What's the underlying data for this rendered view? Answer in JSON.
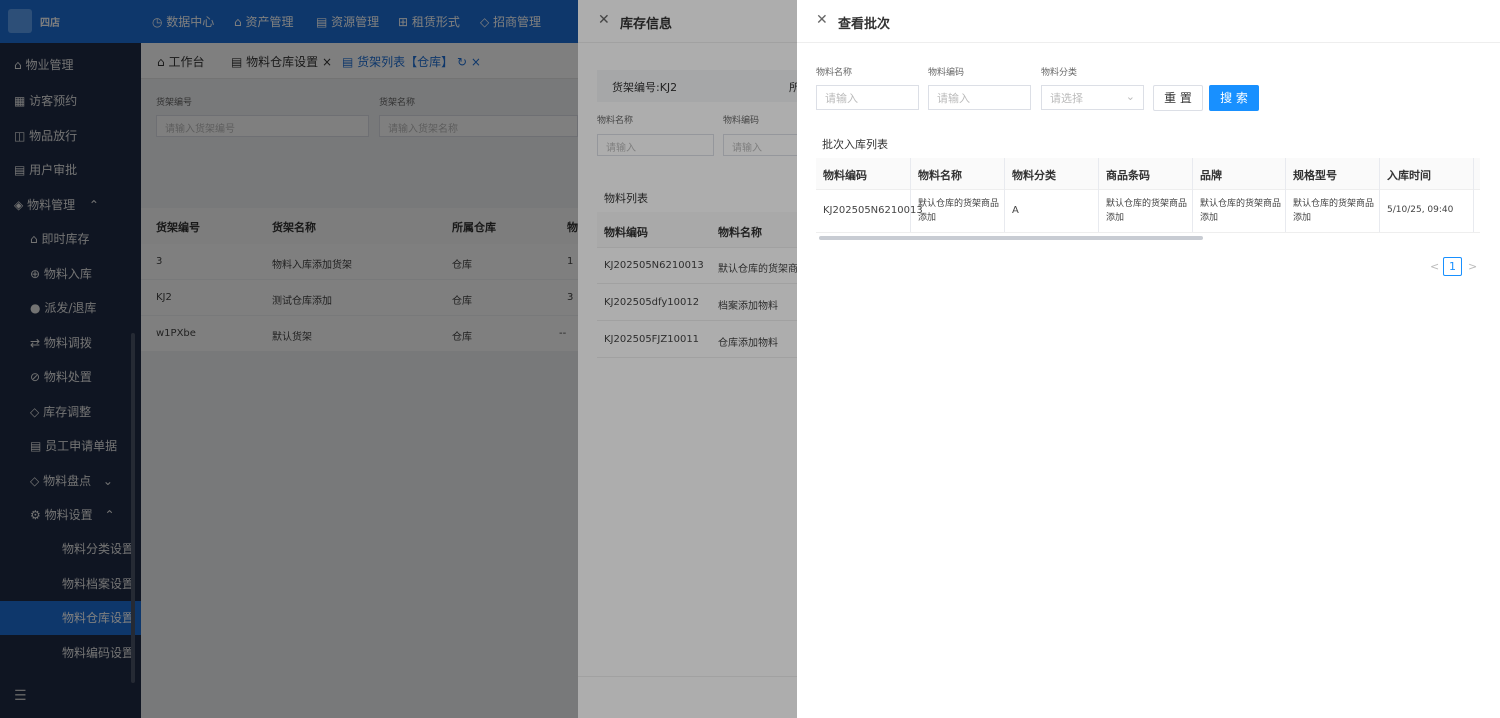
{
  "header": {
    "org_name": "四店",
    "nav": [
      "数据中心",
      "资产管理",
      "资源管理",
      "租赁形式",
      "招商管理"
    ]
  },
  "sidebar": {
    "items": [
      {
        "label": "物业管理",
        "icon": "home-icon"
      },
      {
        "label": "访客预约",
        "icon": "calendar-icon"
      },
      {
        "label": "物品放行",
        "icon": "box-icon"
      },
      {
        "label": "用户审批",
        "icon": "document-icon"
      },
      {
        "label": "物料管理",
        "icon": "cube-icon",
        "expanded": true
      },
      {
        "label": "即时库存",
        "icon": "warehouse-icon"
      },
      {
        "label": "物料入库",
        "icon": "inbound-icon"
      },
      {
        "label": "派发/退库",
        "icon": "dispatch-icon"
      },
      {
        "label": "物料调拨",
        "icon": "transfer-icon"
      },
      {
        "label": "物料处置",
        "icon": "dispose-icon"
      },
      {
        "label": "库存调整",
        "icon": "adjust-icon"
      },
      {
        "label": "员工申请单据",
        "icon": "form-icon"
      },
      {
        "label": "物料盘点",
        "icon": "inventory-icon"
      },
      {
        "label": "物料设置",
        "icon": "settings-icon",
        "expanded": true
      },
      {
        "label": "物料分类设置"
      },
      {
        "label": "物料档案设置"
      },
      {
        "label": "物料仓库设置",
        "active": true
      },
      {
        "label": "物料编码设置"
      }
    ]
  },
  "main": {
    "tabs": [
      {
        "label": "工作台"
      },
      {
        "label": "物料仓库设置"
      },
      {
        "label": "货架列表【仓库】",
        "active": true
      }
    ],
    "filters": {
      "code_label": "货架编号",
      "code_placeholder": "请输入货架编号",
      "name_label": "货架名称",
      "name_placeholder": "请输入货架名称"
    },
    "table": {
      "headers": [
        "货架编号",
        "货架名称",
        "所属仓库",
        "物"
      ],
      "rows": [
        [
          "3",
          "物料入库添加货架",
          "仓库",
          "1"
        ],
        [
          "KJ2",
          "测试仓库添加",
          "仓库",
          "3"
        ],
        [
          "w1PXbe",
          "默认货架",
          "仓库",
          "--"
        ]
      ]
    }
  },
  "drawer1": {
    "title": "库存信息",
    "shelf_code": "货架编号:KJ2",
    "shelf_extra": "所",
    "filter_name_label": "物料名称",
    "filter_name_placeholder": "请输入",
    "filter_code_label": "物料编码",
    "filter_code_placeholder": "请输入",
    "list_title": "物料列表",
    "table": {
      "headers": [
        "物料编码",
        "物料名称"
      ],
      "rows": [
        [
          "KJ202505N6210013",
          "默认仓库的货架商品"
        ],
        [
          "KJ202505dfy10012",
          "档案添加物料"
        ],
        [
          "KJ202505FJZ10011",
          "仓库添加物料"
        ]
      ]
    }
  },
  "drawer2": {
    "title": "查看批次",
    "filters": {
      "name_label": "物料名称",
      "name_placeholder": "请输入",
      "code_label": "物料编码",
      "code_placeholder": "请输入",
      "category_label": "物料分类",
      "category_placeholder": "请选择"
    },
    "reset_label": "重 置",
    "search_label": "搜 索",
    "list_title": "批次入库列表",
    "table": {
      "headers": [
        "物料编码",
        "物料名称",
        "物料分类",
        "商品条码",
        "品牌",
        "规格型号",
        "入库时间"
      ],
      "rows": [
        [
          "KJ202505N6210013",
          "默认仓库的货架商品添加",
          "A",
          "默认仓库的货架商品添加",
          "默认仓库的货架商品添加",
          "默认仓库的货架商品添加",
          "5/10/25, 09:40"
        ]
      ]
    },
    "pagination": {
      "current": "1",
      "prev": "<",
      "next": ">"
    }
  },
  "colors": {
    "primary": "#1d6fd6",
    "button": "#1890ff",
    "sidebar": "#1e2a44"
  }
}
